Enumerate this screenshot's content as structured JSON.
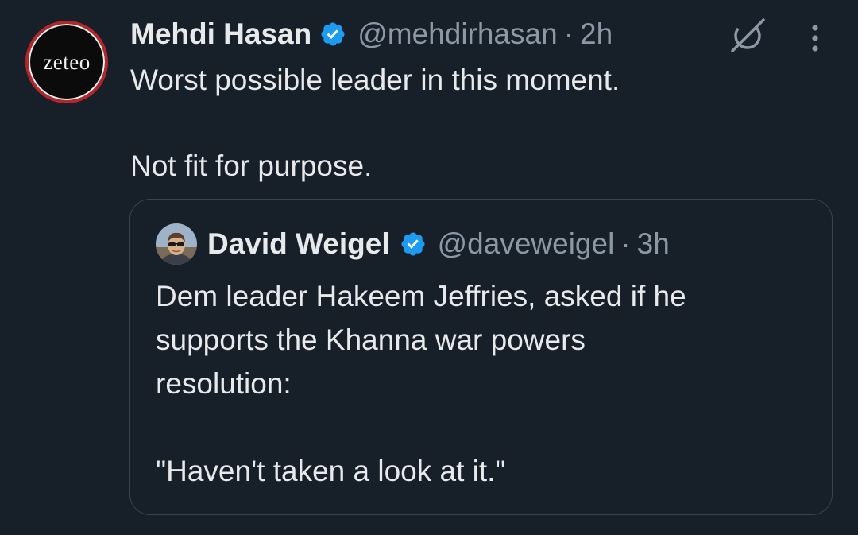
{
  "tweet": {
    "avatar_text": "zeteo",
    "display_name": "Mehdi Hasan",
    "handle": "@mehdirhasan",
    "separator": "·",
    "time": "2h",
    "text_line_1": "Worst possible leader in this moment.",
    "text_line_2": "Not fit for purpose."
  },
  "quote": {
    "display_name": "David Weigel",
    "handle": "@daveweigel",
    "separator": "·",
    "time": "3h",
    "text_line_1": "Dem leader Hakeem Jeffries, asked if he",
    "text_line_2": "supports the Khanna war powers",
    "text_line_3": "resolution:",
    "text_line_4": "\"Haven't taken a look at it.\""
  },
  "icons": {
    "verified": "verified-badge-icon",
    "grok": "grok-icon",
    "more": "more-options-icon"
  },
  "colors": {
    "background": "#171f29",
    "text": "#e7e9ea",
    "secondary_text": "#8b98a5",
    "verified_blue": "#1d9bf0",
    "border": "#38444d"
  }
}
